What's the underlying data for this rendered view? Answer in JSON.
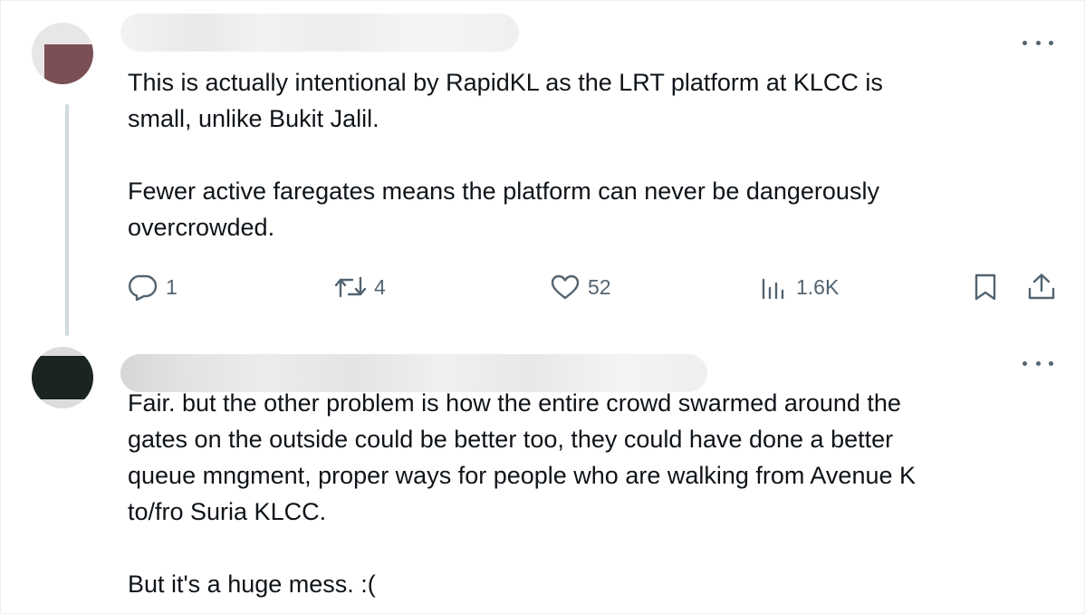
{
  "tweets": [
    {
      "text": "This is actually intentional by RapidKL as the LRT platform at KLCC is\nsmall, unlike Bukit Jalil.\n\nFewer active faregates means the platform can never be dangerously\novercrowded.",
      "icons": {
        "more": "more-icon",
        "reply": "reply-icon",
        "retweet": "retweet-icon",
        "like": "heart-icon",
        "views": "views-icon",
        "bookmark": "bookmark-icon",
        "share": "share-icon"
      },
      "stats": {
        "replies": "1",
        "retweets": "4",
        "likes": "52",
        "views": "1.6K"
      }
    },
    {
      "text": "Fair. but the other problem is how the entire crowd swarmed around the\ngates on the outside could be better too, they could have done a better\nqueue mngment, proper ways for people who are walking from Avenue K\nto/fro Suria KLCC.\n\nBut it's a huge mess. :(",
      "icons": {
        "more": "more-icon"
      }
    }
  ],
  "colors": {
    "text": "#0f1419",
    "secondary": "#536471",
    "thread_line": "#cfd9de"
  }
}
